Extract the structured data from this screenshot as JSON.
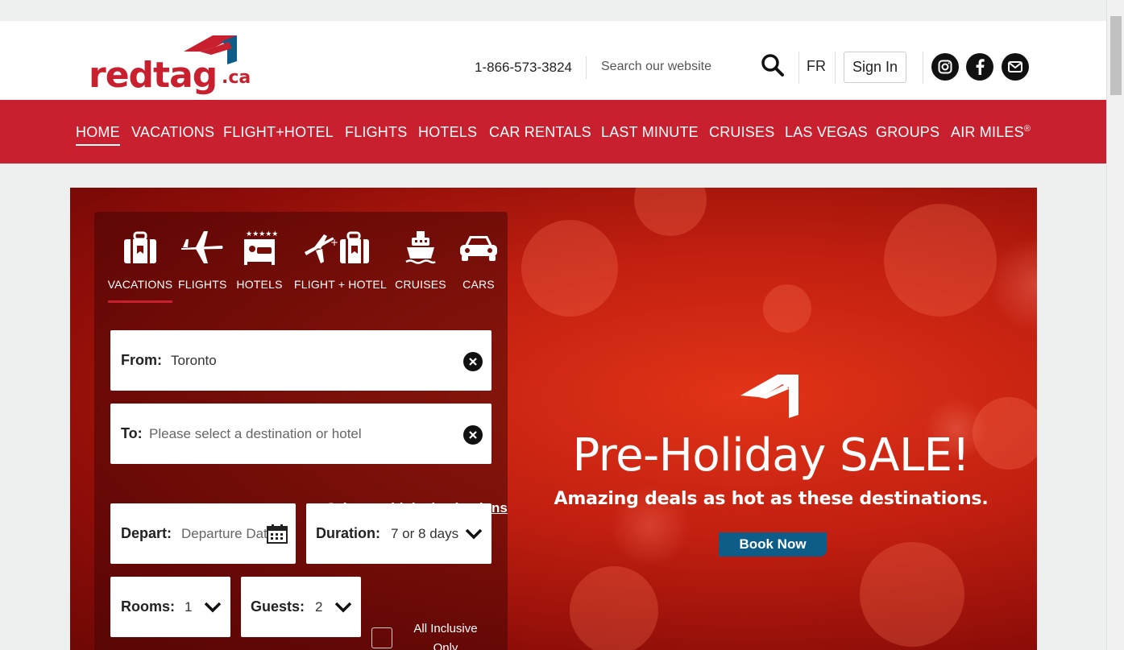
{
  "header": {
    "logo_text": "redtag",
    "logo_tld": ".ca",
    "phone": "1-866-573-3824",
    "search_placeholder": "Search our website",
    "lang": "FR",
    "signin": "Sign In",
    "social_icons": [
      "instagram-icon",
      "facebook-icon",
      "email-icon"
    ]
  },
  "nav": {
    "items": [
      "HOME",
      "VACATIONS",
      "FLIGHT+HOTEL",
      "FLIGHTS",
      "HOTELS",
      "CAR RENTALS",
      "LAST MINUTE",
      "CRUISES",
      "LAS VEGAS",
      "GROUPS",
      "AIR MILES"
    ],
    "air_miles_mark": "®",
    "active": "HOME"
  },
  "search_panel": {
    "tabs": [
      "VACATIONS",
      "FLIGHTS",
      "HOTELS",
      "FLIGHT + HOTEL",
      "CRUISES",
      "CARS"
    ],
    "active_tab": "VACATIONS",
    "from_label": "From:",
    "from_value": "Toronto",
    "to_label": "To:",
    "to_placeholder": "Please select a destination or hotel",
    "multi_link": "Select multiple destinations",
    "depart_label": "Depart:",
    "depart_placeholder": "Departure Date",
    "duration_label": "Duration:",
    "duration_value": "7 or 8 days",
    "rooms_label": "Rooms:",
    "rooms_value": "1",
    "guests_label": "Guests:",
    "guests_value": "2",
    "all_inclusive": "All Inclusive Only"
  },
  "promo": {
    "title": "Pre-Holiday SALE!",
    "subtitle": "Amazing deals as hot as these destinations.",
    "button": "Book Now"
  },
  "colors": {
    "brand_red": "#c8202e",
    "book_blue": "#0e5d88"
  }
}
